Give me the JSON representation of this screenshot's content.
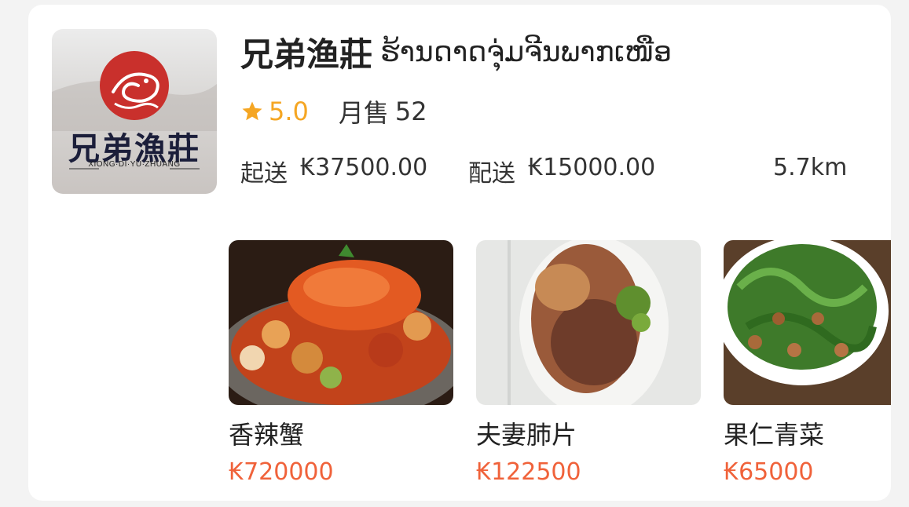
{
  "store": {
    "name_zh": "兄弟渔莊",
    "name_lo": "ຮ້ານດາດຈຸ່ມຈີນພາກເໜືອ",
    "logo_text": "兄弟漁莊",
    "logo_subtext": "XIONG·DI·YU·ZHUANG",
    "rating": "5.0",
    "monthly_sales_label": "月售",
    "monthly_sales": "52",
    "min_order_label": "起送",
    "min_order": "₭37500.00",
    "delivery_fee_label": "配送",
    "delivery_fee": "₭15000.00",
    "distance": "5.7km"
  },
  "products": [
    {
      "name": "香辣蟹",
      "price": "₭720000",
      "image": "spicy-crab-photo"
    },
    {
      "name": "夫妻肺片",
      "price": "₭122500",
      "image": "sliced-beef-photo"
    },
    {
      "name": "果仁青菜",
      "price": "₭65000",
      "image": "peanut-greens-photo"
    }
  ],
  "colors": {
    "accent_star": "#f5a623",
    "price": "#f0623a",
    "logo_red": "#c9302c"
  }
}
